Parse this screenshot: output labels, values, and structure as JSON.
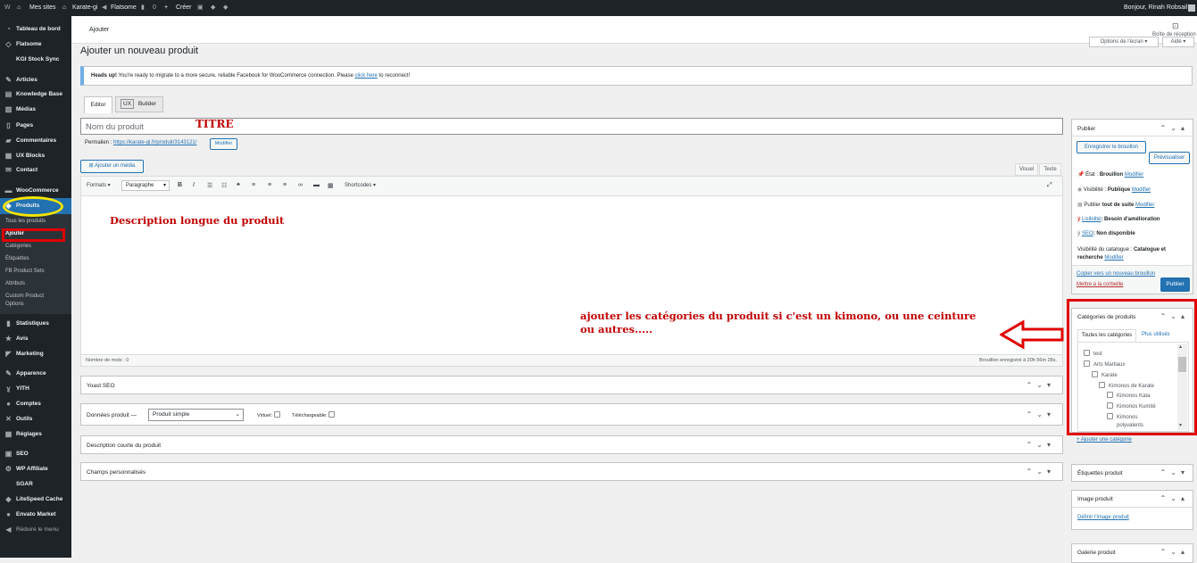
{
  "admin_bar": {
    "wp_logo": "W",
    "my_sites": "Mes sites",
    "site_name": "Karate-gi",
    "theme": "Flatsome",
    "comments": "0",
    "new": "Créer",
    "greeting": "Bonjour, Rinah Robsail"
  },
  "sidebar": {
    "items": [
      {
        "label": "Tableau de bord",
        "icon": "dashboard-icon"
      },
      {
        "label": "Flatsome",
        "icon": "flatsome-icon"
      },
      {
        "label": "KGI Stock Sync",
        "icon": "sync-icon"
      },
      {
        "label": "Articles",
        "icon": "pin-icon"
      },
      {
        "label": "Knowledge Base",
        "icon": "book-icon"
      },
      {
        "label": "Médias",
        "icon": "media-icon"
      },
      {
        "label": "Pages",
        "icon": "page-icon"
      },
      {
        "label": "Commentaires",
        "icon": "comment-icon"
      },
      {
        "label": "UX Blocks",
        "icon": "block-icon"
      },
      {
        "label": "Contact",
        "icon": "mail-icon"
      },
      {
        "label": "WooCommerce",
        "icon": "woo-icon"
      },
      {
        "label": "Produits",
        "icon": "products-icon"
      },
      {
        "label": "Statistiques",
        "icon": "chart-icon"
      },
      {
        "label": "Avis",
        "icon": "star-icon"
      },
      {
        "label": "Marketing",
        "icon": "megaphone-icon"
      },
      {
        "label": "Apparence",
        "icon": "brush-icon"
      },
      {
        "label": "YITH",
        "icon": "yith-icon"
      },
      {
        "label": "Comptes",
        "icon": "users-icon"
      },
      {
        "label": "Outils",
        "icon": "wrench-icon"
      },
      {
        "label": "Réglages",
        "icon": "settings-icon"
      },
      {
        "label": "SEO",
        "icon": "yoast-icon"
      },
      {
        "label": "WP Affiliate",
        "icon": "affiliate-icon"
      },
      {
        "label": "SGAR",
        "icon": "sgar-icon"
      },
      {
        "label": "LiteSpeed Cache",
        "icon": "litespeed-icon"
      },
      {
        "label": "Envato Market",
        "icon": "envato-icon"
      }
    ],
    "collapse": "Réduire le menu",
    "submenu": [
      "Tous les produits",
      "Ajouter",
      "Catégories",
      "Étiquettes",
      "FB Product Sets",
      "Attributs",
      "Custom Product",
      "Options"
    ]
  },
  "topbar": {
    "breadcrumb": "Ajouter",
    "inbox": "Boîte de réception",
    "screen_options": "Options de l'écran",
    "help": "Aide"
  },
  "page": {
    "title": "Ajouter un nouveau produit",
    "notice_strong": "Heads up!",
    "notice_text": "You're ready to migrate to a more secure, reliable Facebook for WooCommerce connection. Please",
    "notice_link": "click here",
    "notice_end": "to reconnect!",
    "tab_editor": "Editor",
    "tab_ux": "UX",
    "tab_builder": "Builder",
    "title_placeholder": "Nom du produit",
    "permalink_label": "Permalien :",
    "permalink_url": "https://karate-gi.fr/produit/3143121/",
    "permalink_edit": "Modifier",
    "add_media": "Ajouter un média",
    "tab_visual": "Visuel",
    "tab_text": "Texte",
    "formats": "Formats",
    "paragraph": "Paragraphe",
    "shortcodes": "Shortcodes",
    "word_count": "Nombre de mots : 0",
    "draft_saved": "Brouillon enregistré à 20h 56m 28s."
  },
  "annotations": {
    "title": "TITRE",
    "description": "Description longue du produit",
    "categories_line1": "ajouter les catégories du produit si c'est un kimono, ou une ceinture",
    "categories_line2": "ou autres....."
  },
  "metaboxes": {
    "yoast": "Yoast SEO",
    "product_data": "Données produit —",
    "product_type": "Produit simple",
    "virtual": "Virtuel:",
    "downloadable": "Téléchargeable:",
    "short_desc": "Description courte du produit",
    "custom_fields": "Champs personnalisés"
  },
  "publish": {
    "title": "Publier",
    "save_draft": "Enregistrer le brouillon",
    "preview": "Prévisualiser",
    "status_label": "État :",
    "status_value": "Brouillon",
    "visibility_label": "Visibilité :",
    "visibility_value": "Publique",
    "publish_label": "Publier",
    "publish_value": "tout de suite",
    "readability_label": "Lisibilité",
    "readability_value": ": Besoin d'amélioration",
    "seo_label": "SEO",
    "seo_value": ": Non disponible",
    "catalog_label": "Visibilité du catalogue :",
    "catalog_value": "Catalogue et",
    "catalog_value2": "recherche",
    "edit": "Modifier",
    "copy_draft": "Copier vers un nouveau brouillon",
    "trash": "Mettre à la corbeille",
    "publish_button": "Publier"
  },
  "categories": {
    "title": "Catégories de produits",
    "tab_all": "Toutes les catégories",
    "tab_used": "Plus utilisés",
    "items": [
      "test",
      "Arts Martiaux",
      "Karate",
      "Kimonos de Karate",
      "Kimonos Kata",
      "Kimonos Kumité",
      "Kimonos",
      "polyvalents"
    ],
    "add": "+ Ajouter une catégorie"
  },
  "tags_box": {
    "title": "Étiquettes produit"
  },
  "image_box": {
    "title": "Image produit",
    "link": "Définir l'image produit"
  },
  "gallery_box": {
    "title": "Galerie produit"
  },
  "colors": {
    "accent": "#2271b1",
    "sidebar": "#1d2327",
    "active": "#2271b1",
    "annotation": "#c00000"
  }
}
